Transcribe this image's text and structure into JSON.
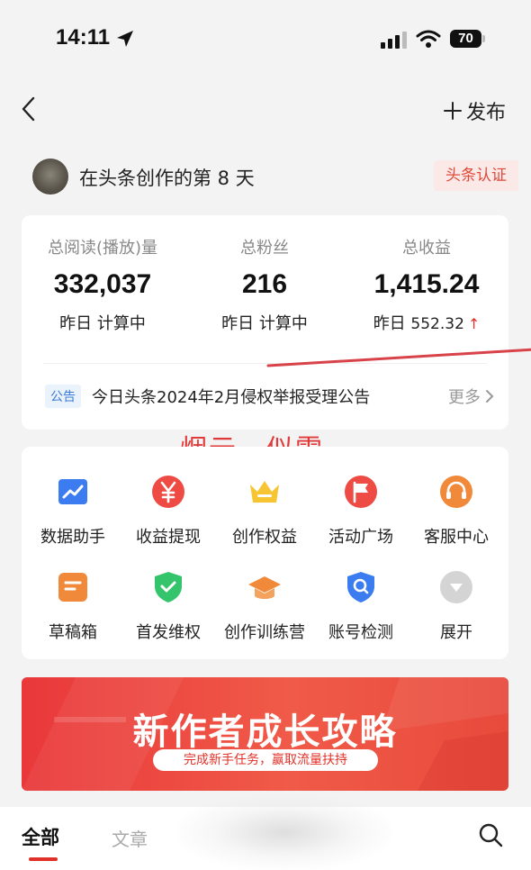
{
  "status_bar": {
    "time": "14:11",
    "battery": "70"
  },
  "nav": {
    "publish_label": "发布"
  },
  "creator": {
    "text": "在头条创作的第 8 天",
    "badge": "头条认证"
  },
  "stats": [
    {
      "label": "总阅读(播放)量",
      "value": "332,037",
      "sub_prefix": "昨日",
      "sub_value": "计算中",
      "trend": ""
    },
    {
      "label": "总粉丝",
      "value": "216",
      "sub_prefix": "昨日",
      "sub_value": "计算中",
      "trend": ""
    },
    {
      "label": "总收益",
      "value": "1,415.24",
      "sub_prefix": "昨日",
      "sub_value": "552.32",
      "trend": "↑"
    }
  ],
  "notice": {
    "tag": "公告",
    "text": "今日头条2024年2月侵权举报受理公告",
    "more": "更多"
  },
  "watermark": "烟云、似雪",
  "tools": [
    {
      "label": "数据助手",
      "icon": "chart-icon",
      "color": "#3b7cf0"
    },
    {
      "label": "收益提现",
      "icon": "yuan-icon",
      "color": "#ee4b44"
    },
    {
      "label": "创作权益",
      "icon": "crown-icon",
      "color": "#f6c531"
    },
    {
      "label": "活动广场",
      "icon": "flag-icon",
      "color": "#ee4b44"
    },
    {
      "label": "客服中心",
      "icon": "headset-icon",
      "color": "#f08a3a"
    },
    {
      "label": "草稿箱",
      "icon": "draft-icon",
      "color": "#f08a3a"
    },
    {
      "label": "首发维权",
      "icon": "shield-icon",
      "color": "#34c46c"
    },
    {
      "label": "创作训练营",
      "icon": "graduation-cap-icon",
      "color": "#f08a3a"
    },
    {
      "label": "账号检测",
      "icon": "search-shield-icon",
      "color": "#3b7cf0"
    },
    {
      "label": "展开",
      "icon": "expand-icon",
      "color": "#cccccc"
    }
  ],
  "banner": {
    "title": "新作者成长攻略",
    "subtitle": "完成新手任务，赢取流量扶持"
  },
  "bottom_tabs": {
    "all": "全部",
    "article": "文章"
  },
  "colors": {
    "accent": "#e0322a",
    "background": "#f3f3f3"
  }
}
